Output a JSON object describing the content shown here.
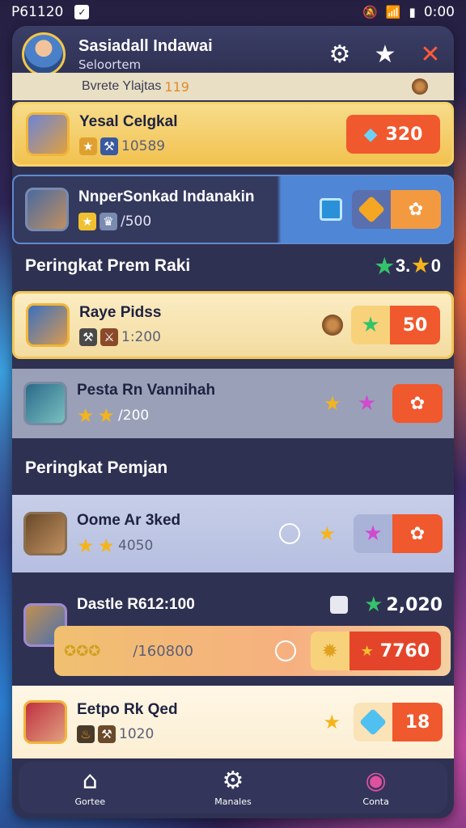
{
  "status_bar": {
    "left_text": "P61120",
    "time": "0:00"
  },
  "header": {
    "title": "Sasiadall Indawai",
    "subtitle": "Seloortem"
  },
  "partial_top_row": {
    "text": "Bvrete Ylajtas",
    "value": "119"
  },
  "rows": [
    {
      "name": "Yesal Celgkal",
      "value": "10589",
      "amount": "320",
      "theme": "gold"
    },
    {
      "name": "NnperSonkad Indanakin",
      "value": "/500",
      "amount": "",
      "theme": "blue"
    },
    {
      "name": "Raye Pidss",
      "value": "1:200",
      "amount": "50",
      "theme": "gold"
    },
    {
      "name": "Pesta Rn Vannihah",
      "value": "/200",
      "amount": "",
      "theme": "grey"
    },
    {
      "name": "Oome Ar 3ked",
      "value": "4050",
      "amount": "",
      "theme": "light"
    },
    {
      "name": "Dastle R612:100",
      "value": "/160800",
      "amount": "7760",
      "theme": "dark"
    },
    {
      "name": "Eetpo Rk Qed",
      "value": "1020",
      "amount": "18",
      "theme": "cream"
    }
  ],
  "sections": [
    {
      "title": "Peringkat Prem Raki",
      "right_value": "3.",
      "right_value2": "0"
    },
    {
      "title": "Peringkat Pemjan"
    }
  ],
  "row6_right_value": "2,020",
  "tabs": [
    {
      "label": "Gortee",
      "icon": "home-icon"
    },
    {
      "label": "Manales",
      "icon": "settings-icon"
    },
    {
      "label": "Conta",
      "icon": "gem-icon"
    }
  ]
}
